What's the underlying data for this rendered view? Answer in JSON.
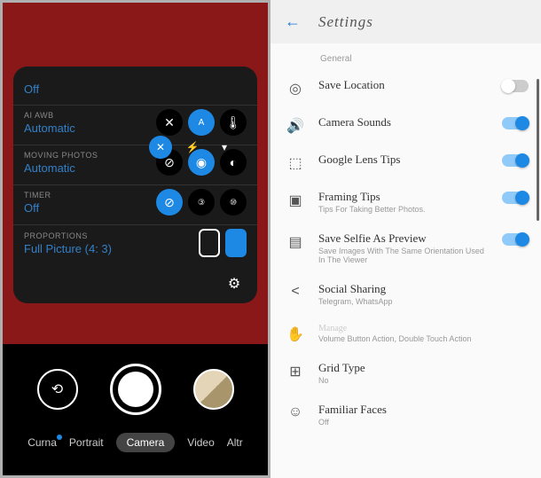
{
  "camera": {
    "settings": [
      {
        "label": "",
        "value": "Off"
      },
      {
        "label": "AI AWB",
        "value": "Automatic"
      },
      {
        "label": "MOVING PHOTOS",
        "value": "Automatic"
      },
      {
        "label": "TIMER",
        "value": "Off"
      },
      {
        "label": "PROPORTIONS",
        "value": "Full Picture (4: 3)"
      }
    ],
    "modes": [
      "Curna",
      "Portrait",
      "Camera",
      "Video",
      "Altr"
    ],
    "active_mode": "Camera"
  },
  "settings_panel": {
    "title": "Settings",
    "section": "General",
    "items": [
      {
        "title": "Save Location",
        "sub": "",
        "toggle": "off"
      },
      {
        "title": "Camera Sounds",
        "sub": "",
        "toggle": "on"
      },
      {
        "title": "Google Lens Tips",
        "sub": "",
        "toggle": "on"
      },
      {
        "title": "Framing Tips",
        "sub": "Tips For Taking Better Photos.",
        "toggle": "on"
      },
      {
        "title": "Save Selfie As Preview",
        "sub": "Save Images With The Same Orientation Used In The Viewer",
        "toggle": "on"
      },
      {
        "title": "Social Sharing",
        "sub": "Telegram, WhatsApp",
        "toggle": null
      },
      {
        "title": "Manage",
        "sub": "Volume Button Action, Double Touch Action",
        "toggle": null
      },
      {
        "title": "Grid Type",
        "sub": "No",
        "toggle": null
      },
      {
        "title": "Familiar Faces",
        "sub": "Off",
        "toggle": null
      }
    ]
  }
}
